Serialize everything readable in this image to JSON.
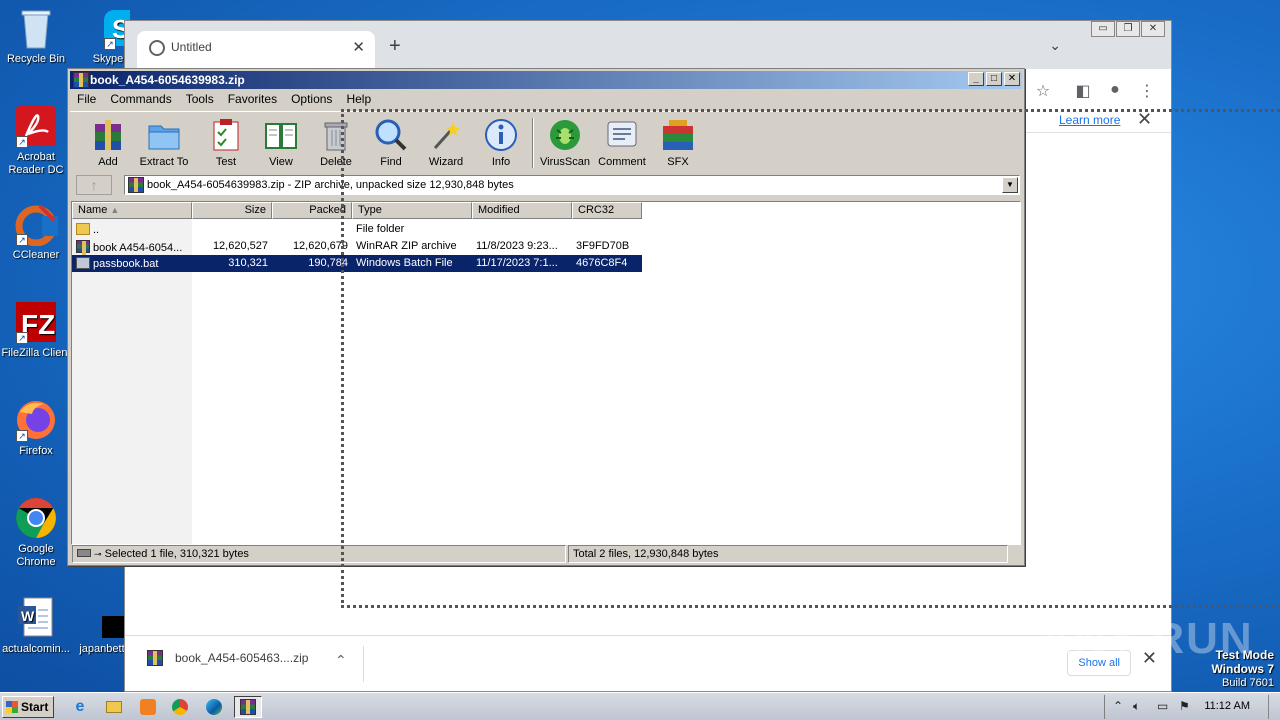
{
  "desktop": {
    "icons": [
      {
        "label": "Recycle Bin"
      },
      {
        "label": "Skype"
      },
      {
        "label": "Acrobat Reader DC"
      },
      {
        "label": "CCleaner"
      },
      {
        "label": "FileZilla Client"
      },
      {
        "label": "Firefox"
      },
      {
        "label": "Google Chrome"
      },
      {
        "label": "actualcomin..."
      },
      {
        "label": "japanbett"
      }
    ]
  },
  "chrome": {
    "tab_title": "Untitled",
    "tab_close": "✕",
    "new_tab": "+",
    "learn_more": "Learn more",
    "download_file": "book_A454-605463....zip",
    "show_all": "Show all"
  },
  "winrar": {
    "title": "book_A454-6054639983.zip",
    "menu": [
      "File",
      "Commands",
      "Tools",
      "Favorites",
      "Options",
      "Help"
    ],
    "toolbar": [
      {
        "label": "Add",
        "icon": "add-archive-icon"
      },
      {
        "label": "Extract To",
        "icon": "extract-folder-icon"
      },
      {
        "label": "Test",
        "icon": "test-checklist-icon"
      },
      {
        "label": "View",
        "icon": "view-book-icon"
      },
      {
        "label": "Delete",
        "icon": "trash-can-icon"
      },
      {
        "label": "Find",
        "icon": "magnifier-icon"
      },
      {
        "label": "Wizard",
        "icon": "magic-wand-icon"
      },
      {
        "label": "Info",
        "icon": "info-icon"
      },
      {
        "label": "VirusScan",
        "icon": "bug-scan-icon"
      },
      {
        "label": "Comment",
        "icon": "comment-icon"
      },
      {
        "label": "SFX",
        "icon": "sfx-books-icon"
      }
    ],
    "address": "book_A454-6054639983.zip - ZIP archive, unpacked size 12,930,848 bytes",
    "columns": [
      "Name",
      "Size",
      "Packed",
      "Type",
      "Modified",
      "CRC32"
    ],
    "rows": [
      {
        "name": "..",
        "size": "",
        "packed": "",
        "type": "File folder",
        "modified": "",
        "crc": "",
        "selected": false
      },
      {
        "name": "book A454-6054...",
        "size": "12,620,527",
        "packed": "12,620,679",
        "type": "WinRAR ZIP archive",
        "modified": "11/8/2023 9:23...",
        "crc": "3F9FD70B",
        "selected": false
      },
      {
        "name": "passbook.bat",
        "size": "310,321",
        "packed": "190,784",
        "type": "Windows Batch File",
        "modified": "11/17/2023 7:1...",
        "crc": "4676C8F4",
        "selected": true
      }
    ],
    "status_left": "Selected 1 file, 310,321 bytes",
    "status_right": "Total 2 files, 12,930,848 bytes"
  },
  "watermark": "ANY RUN",
  "testmode": {
    "line1": "Test Mode",
    "line2": "Windows 7",
    "line3": "Build 7601"
  },
  "taskbar": {
    "start": "Start",
    "clock": "11:12 AM"
  }
}
